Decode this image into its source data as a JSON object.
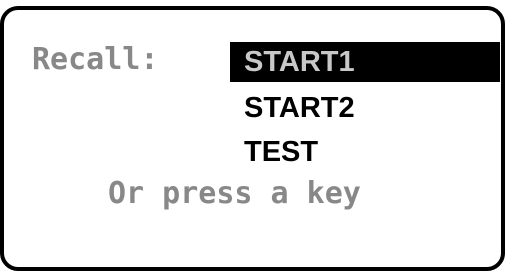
{
  "recall_label": "Recall:",
  "menu": {
    "selected_index": 0,
    "items": [
      {
        "label": "START1"
      },
      {
        "label": "START2"
      },
      {
        "label": "TEST"
      }
    ]
  },
  "hint": "Or press a key",
  "colors": {
    "border": "#000000",
    "label_text": "#888888",
    "selected_bg": "#000000",
    "selected_text": "#c8c8c8",
    "item_text": "#000000"
  }
}
